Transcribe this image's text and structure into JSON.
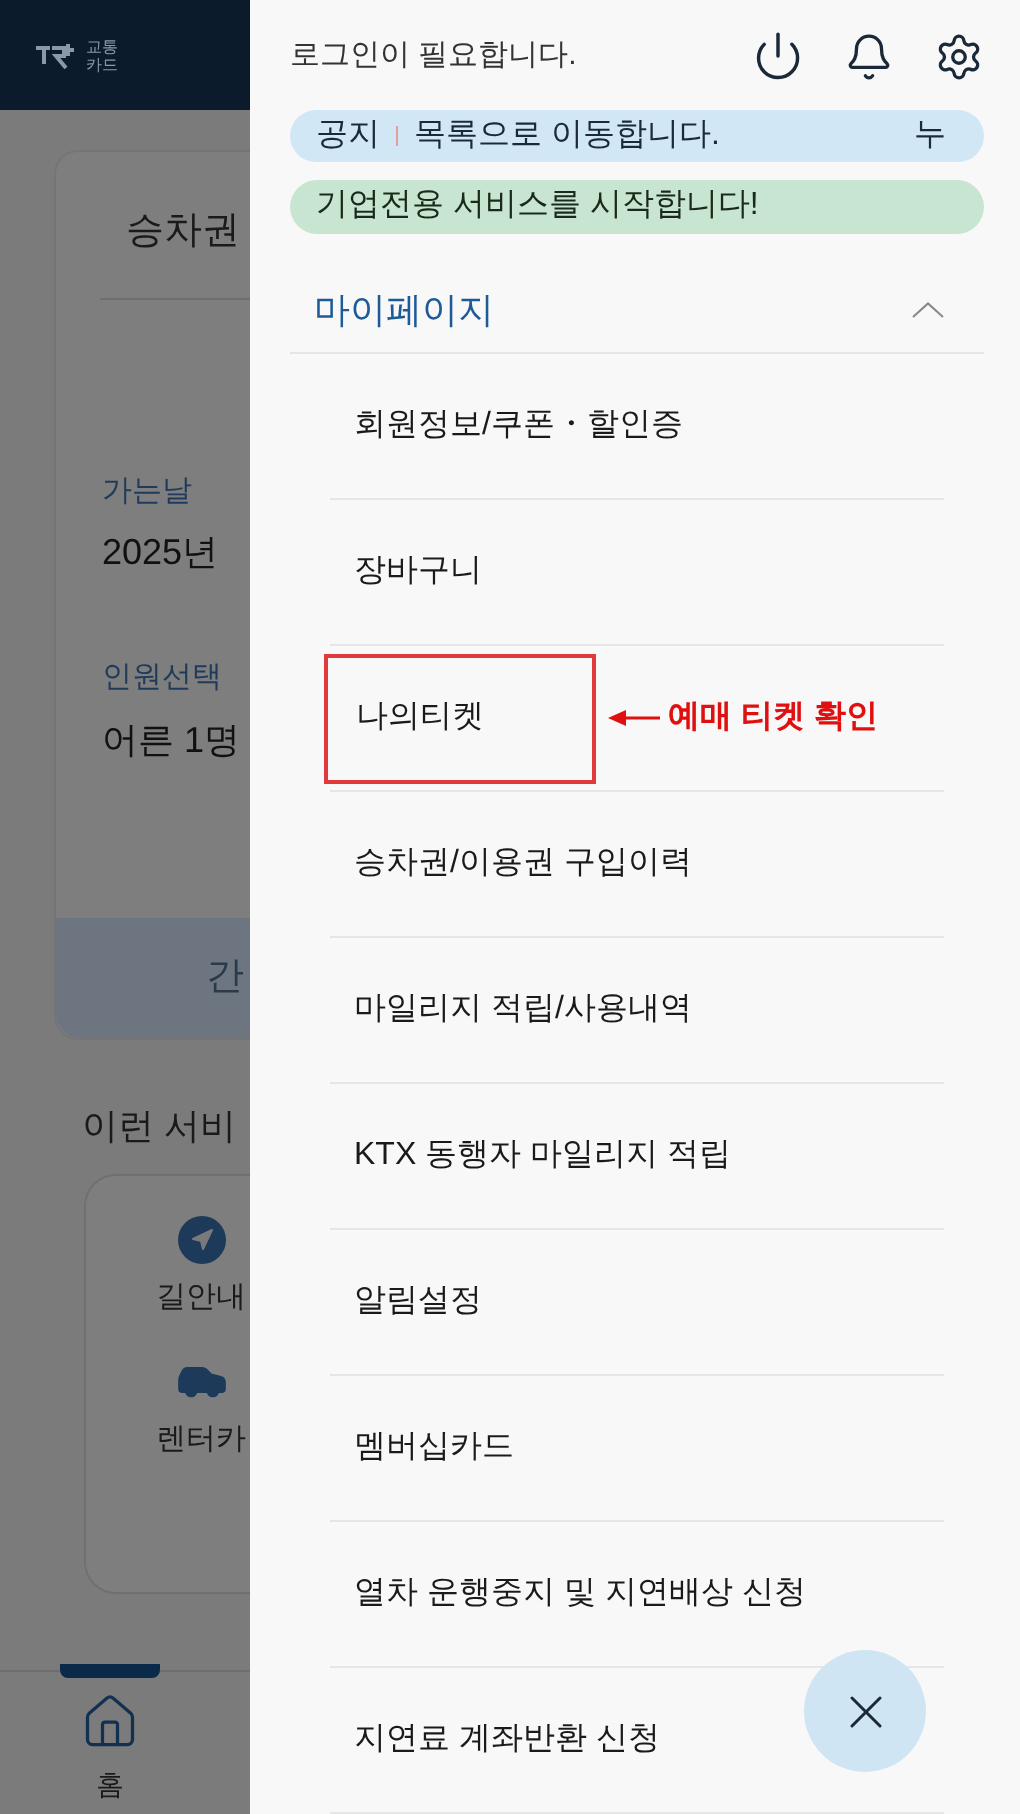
{
  "background": {
    "logo": [
      "교통",
      "카드"
    ],
    "tab": "승차권",
    "date_label": "가는날",
    "date_value": "2025년",
    "people_label": "인원선택",
    "people_value": "어른 1명",
    "button": "간",
    "services_title": "이런 서비",
    "services": [
      {
        "kind": "navigation",
        "label": "길안내"
      },
      {
        "kind": "car",
        "label": "렌터카"
      }
    ],
    "nav": [
      {
        "label": "홈",
        "selected": true
      }
    ]
  },
  "drawer": {
    "login_text": "로그인이 필요합니다.",
    "notice": {
      "label": "공지",
      "text": "목록으로 이동합니다.",
      "trailing": "누"
    },
    "banner": "기업전용 서비스를 시작합니다!",
    "section": {
      "title": "마이페이지",
      "expanded": true,
      "items": [
        {
          "label": "회원정보/쿠폰・할인증",
          "highlighted": false
        },
        {
          "label": "장바구니",
          "highlighted": false
        },
        {
          "label": "나의티켓",
          "highlighted": true,
          "annotation": "예매 티켓 확인"
        },
        {
          "label": "승차권/이용권 구입이력",
          "highlighted": false
        },
        {
          "label": "마일리지 적립/사용내역",
          "highlighted": false
        },
        {
          "label": "KTX 동행자 마일리지 적립",
          "highlighted": false
        },
        {
          "label": "알림설정",
          "highlighted": false
        },
        {
          "label": "멤버십카드",
          "highlighted": false
        },
        {
          "label": "열차 운행중지 및 지연배상 신청",
          "highlighted": false
        },
        {
          "label": "지연료 계좌반환 신청",
          "highlighted": false
        }
      ]
    }
  }
}
